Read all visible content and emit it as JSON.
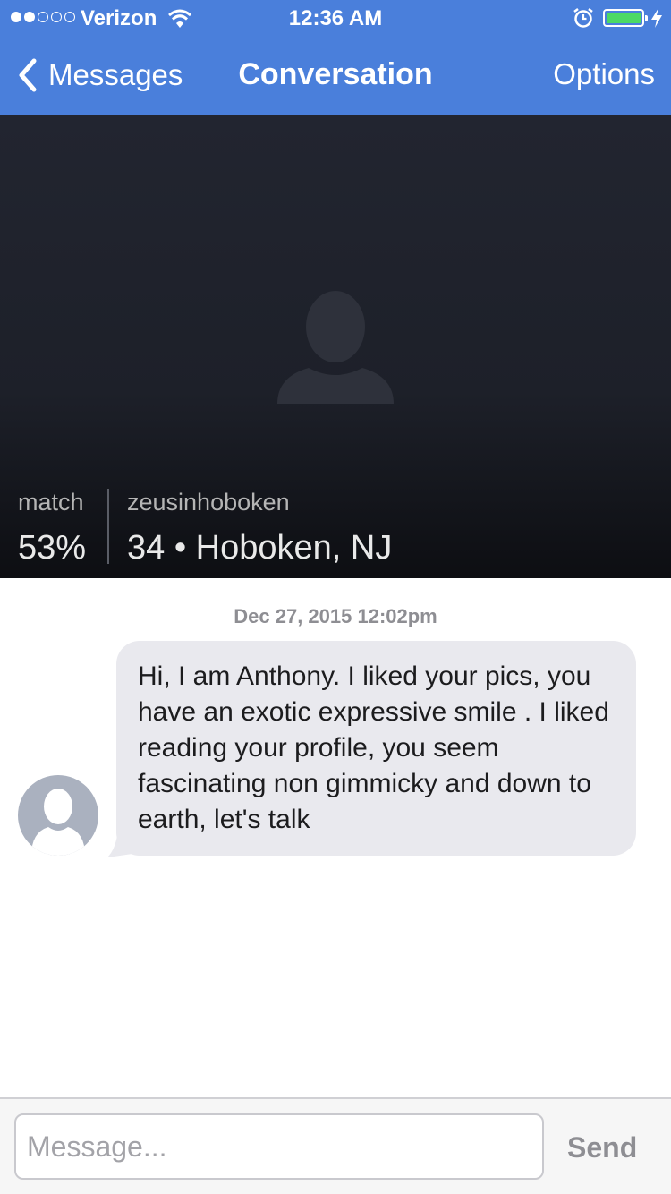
{
  "status_bar": {
    "carrier": "Verizon",
    "signal_bars": 2,
    "time": "12:36 AM",
    "battery_level": 1.0,
    "battery_color": "#4cd964"
  },
  "nav": {
    "back_label": "Messages",
    "title": "Conversation",
    "options_label": "Options",
    "bar_color": "#4a7fdb"
  },
  "profile": {
    "match_label": "match",
    "match_value": "53%",
    "username": "zeusinhoboken",
    "age_location": "34 • Hoboken, NJ",
    "photo_icon": "person-silhouette-icon"
  },
  "conversation": {
    "timestamp": "Dec 27, 2015 12:02pm",
    "messages": [
      {
        "sender_avatar_icon": "person-avatar-icon",
        "text": "Hi, I am Anthony. I liked your pics, you have an exotic expressive smile . I liked reading your profile, you seem fascinating non gimmicky and down to earth, let's talk"
      }
    ]
  },
  "composer": {
    "placeholder": "Message...",
    "value": "",
    "send_label": "Send"
  }
}
